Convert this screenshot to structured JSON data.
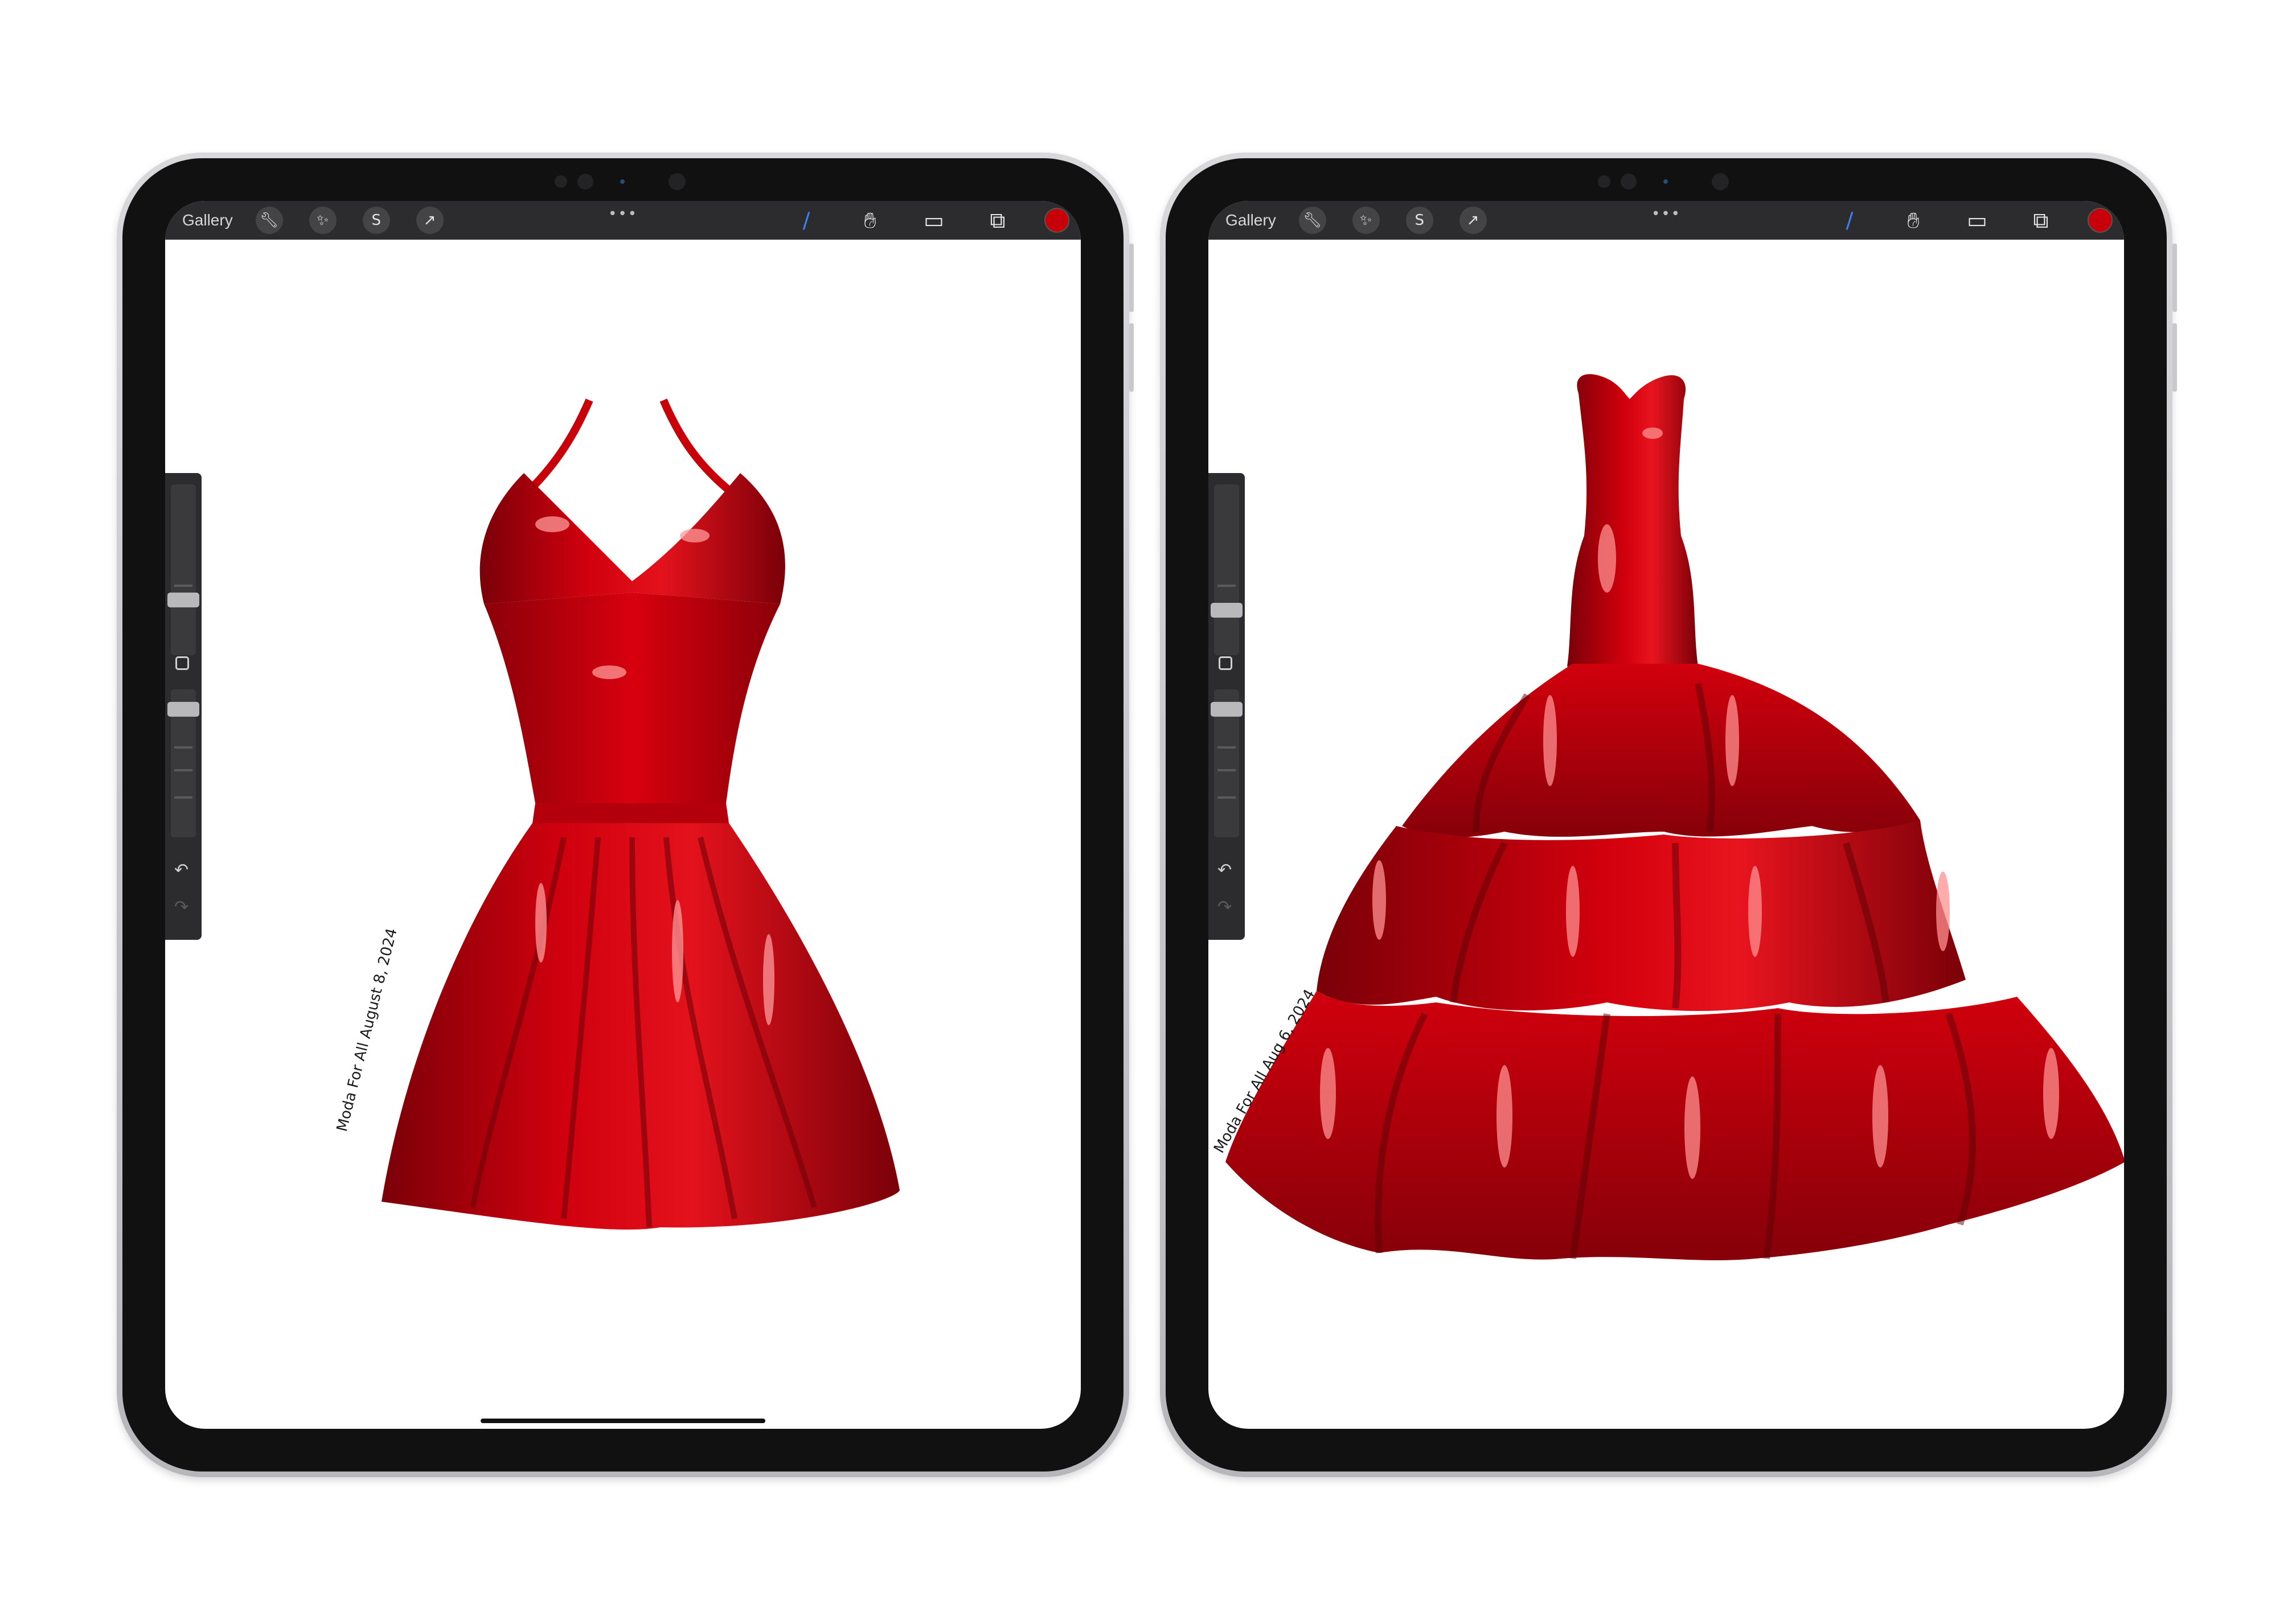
{
  "ipads": [
    {
      "toolbar": {
        "gallery_label": "Gallery",
        "left_tools": [
          "wrench-icon",
          "magic-wand-icon",
          "selection-icon",
          "transform-arrow-icon"
        ],
        "right_tools": [
          "brush-icon",
          "smudge-icon",
          "eraser-icon",
          "layers-icon"
        ],
        "color_hex": "#c8000a"
      },
      "artwork": {
        "subject": "red-halter-mini-dress",
        "signature": "Moda For All August 8, 2024"
      }
    },
    {
      "toolbar": {
        "gallery_label": "Gallery",
        "left_tools": [
          "wrench-icon",
          "magic-wand-icon",
          "selection-icon",
          "transform-arrow-icon"
        ],
        "right_tools": [
          "brush-icon",
          "smudge-icon",
          "eraser-icon",
          "layers-icon"
        ],
        "color_hex": "#c8000a"
      },
      "artwork": {
        "subject": "red-tiered-ball-gown",
        "signature": "Moda For All Aug 6, 2024"
      }
    }
  ],
  "colors": {
    "dress_red": "#c8000a",
    "dress_dark": "#7a0008",
    "highlight": "#ff8a8a"
  }
}
